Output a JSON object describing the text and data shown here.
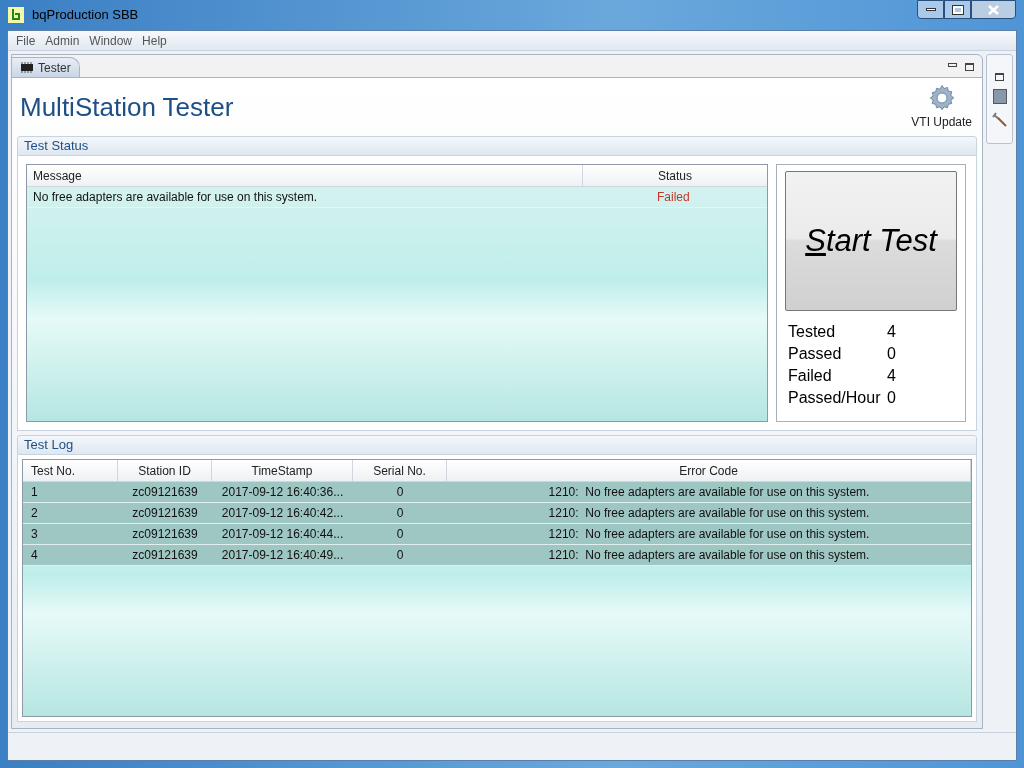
{
  "window": {
    "title": "bqProduction SBB"
  },
  "menu": [
    "File",
    "Admin",
    "Window",
    "Help"
  ],
  "view_tab": {
    "label": "Tester",
    "selected": true
  },
  "header": {
    "title": "MultiStation Tester",
    "update_button": "VTI Update"
  },
  "test_status": {
    "title": "Test Status",
    "columns": [
      "Message",
      "Status"
    ],
    "rows": [
      {
        "message": "No free adapters are available for use on this system.",
        "status": "Failed",
        "kind": "failed"
      }
    ],
    "start_button": {
      "mnemonic": "S",
      "rest": "tart Test"
    },
    "stats": [
      {
        "label": "Tested",
        "value": "4"
      },
      {
        "label": "Passed",
        "value": "0"
      },
      {
        "label": "Failed",
        "value": "4"
      },
      {
        "label": "Passed/Hour",
        "value": "0"
      }
    ]
  },
  "test_log": {
    "title": "Test Log",
    "columns": [
      "Test No.",
      "Station ID",
      "TimeStamp",
      "Serial No.",
      "Error Code"
    ],
    "rows": [
      {
        "cells": [
          "1",
          "zc09121639",
          "2017-09-12 16:40:36...",
          "0",
          "1210:  No free adapters are available for use on this system."
        ],
        "selected": true
      },
      {
        "cells": [
          "2",
          "zc09121639",
          "2017-09-12 16:40:42...",
          "0",
          "1210:  No free adapters are available for use on this system."
        ],
        "selected": true
      },
      {
        "cells": [
          "3",
          "zc09121639",
          "2017-09-12 16:40:44...",
          "0",
          "1210:  No free adapters are available for use on this system."
        ],
        "selected": true
      },
      {
        "cells": [
          "4",
          "zc09121639",
          "2017-09-12 16:40:49...",
          "0",
          "1210:  No free adapters are available for use on this system."
        ],
        "selected": true
      }
    ]
  }
}
